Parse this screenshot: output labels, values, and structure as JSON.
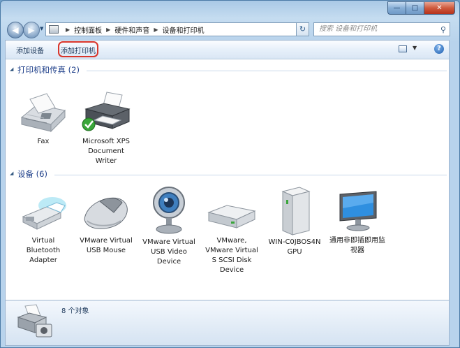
{
  "window": {
    "title_buttons": {
      "minimize": "—",
      "maximize": "□",
      "close": "✕"
    }
  },
  "nav": {
    "back": "◀",
    "forward": "▶",
    "breadcrumbs": [
      "控制面板",
      "硬件和声音",
      "设备和打印机"
    ],
    "search_placeholder": "搜索 设备和打印机",
    "refresh": "↻"
  },
  "commands": {
    "add_device": "添加设备",
    "add_printer": "添加打印机",
    "help": "?"
  },
  "groups": {
    "printers": {
      "title": "打印机和传真 (2)",
      "items": [
        {
          "name": "Fax",
          "icon": "fax-icon"
        },
        {
          "name": "Microsoft XPS Document Writer",
          "icon": "printer-icon",
          "default": true
        }
      ]
    },
    "devices": {
      "title": "设备 (6)",
      "items": [
        {
          "name": "Virtual Bluetooth Adapter",
          "icon": "usb-bluetooth-icon"
        },
        {
          "name": "VMware Virtual USB Mouse",
          "icon": "mouse-icon"
        },
        {
          "name": "VMware Virtual USB Video Device",
          "icon": "webcam-icon"
        },
        {
          "name": "VMware, VMware Virtual S SCSI Disk Device",
          "icon": "disk-drive-icon"
        },
        {
          "name": "WIN-C0JBOS4N GPU",
          "icon": "computer-tower-icon"
        },
        {
          "name": "通用非即插即用监视器",
          "icon": "monitor-icon"
        }
      ]
    }
  },
  "status": {
    "text": "8 个对象"
  },
  "colors": {
    "accent": "#1e3f8a",
    "highlight": "#d9352a"
  }
}
